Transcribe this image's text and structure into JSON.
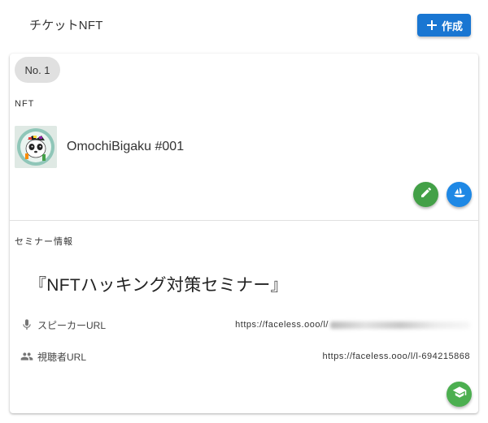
{
  "header": {
    "title": "チケットNFT",
    "create_label": "作成"
  },
  "ticket": {
    "number_label": "No. 1",
    "nft_section_label": "NFT",
    "nft_name": "OmochiBigaku #001",
    "seminar_section_label": "セミナー情報",
    "seminar_title": "『NFTハッキング対策セミナー』",
    "speaker_url_label": "スピーカーURL",
    "speaker_url_value": "https://faceless.ooo/l/",
    "viewer_url_label": "視聴者URL",
    "viewer_url_value": "https://faceless.ooo/l/l-694215868"
  },
  "colors": {
    "primary": "#1976d2",
    "edit_green": "#43a047",
    "opensea_blue": "#1e88e5",
    "school_green": "#4caf50",
    "chip_bg": "#e0e0e0"
  },
  "icons": [
    "plus-icon",
    "pencil-icon",
    "opensea-icon",
    "microphone-icon",
    "people-icon",
    "school-icon"
  ]
}
